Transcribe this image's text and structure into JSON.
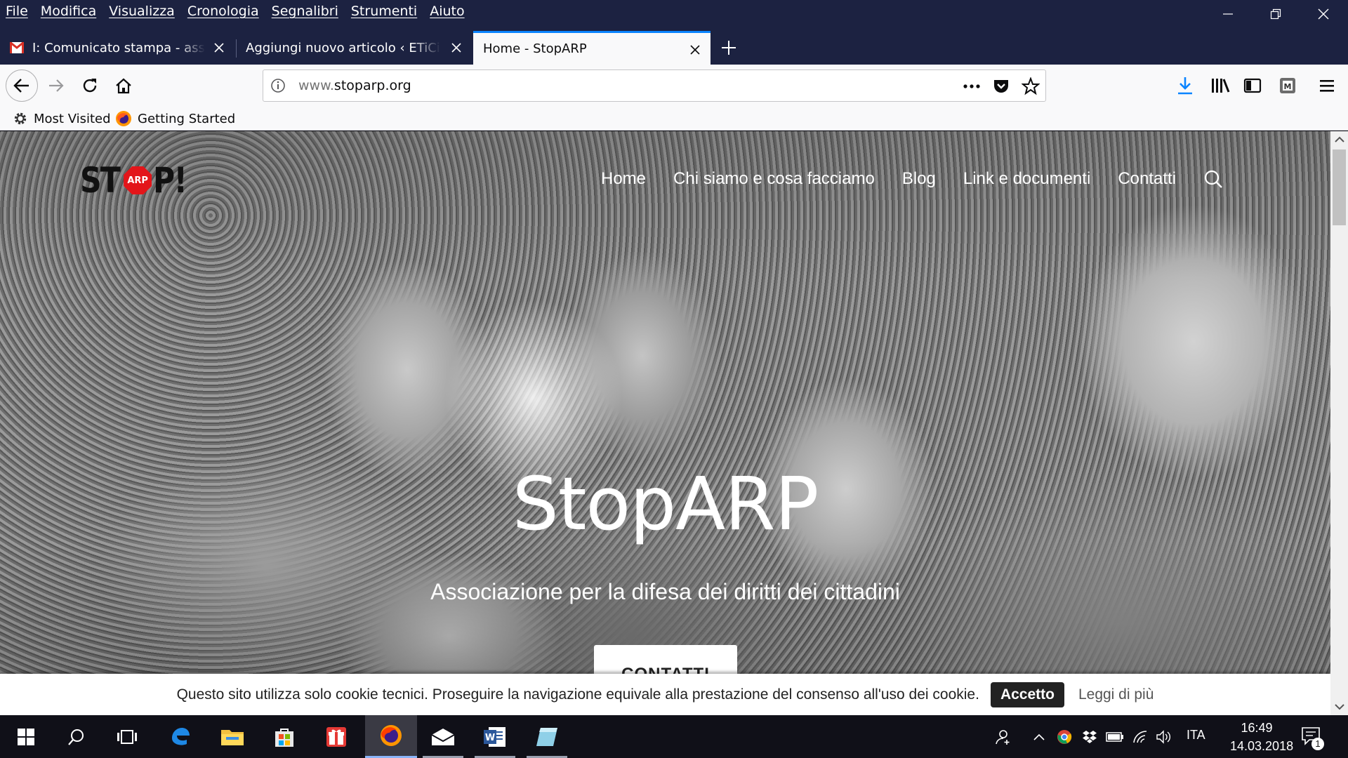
{
  "menu": {
    "items": [
      "File",
      "Modifica",
      "Visualizza",
      "Cronologia",
      "Segnalibri",
      "Strumenti",
      "Aiuto"
    ]
  },
  "tabs": [
    {
      "title": "I: Comunicato stampa - associazione",
      "icon": "gmail-icon",
      "active": false
    },
    {
      "title": "Aggiungi nuovo articolo ‹ ETiCinforma",
      "icon": "",
      "active": false
    },
    {
      "title": "Home - StopARP",
      "icon": "",
      "active": true
    }
  ],
  "urlbar": {
    "url_prefix": "www.",
    "url_domain": "stoparp.org"
  },
  "bookmarks": [
    {
      "label": "Most Visited",
      "icon": "gear-icon"
    },
    {
      "label": "Getting Started",
      "icon": "firefox-icon"
    }
  ],
  "site": {
    "logo": {
      "left": "ST",
      "sign": "ARP",
      "right": "P!"
    },
    "nav": [
      "Home",
      "Chi siamo e cosa facciamo",
      "Blog",
      "Link e documenti",
      "Contatti"
    ],
    "hero_title": "StopARP",
    "hero_subtitle": "Associazione per la difesa dei diritti dei cittadini",
    "hero_button": "CONTATTI"
  },
  "cookie": {
    "text": "Questo sito utilizza solo cookie tecnici. Proseguire la navigazione equivale alla prestazione del consenso all'uso dei cookie.",
    "accept": "Accetto",
    "more": "Leggi di più"
  },
  "taskbar": {
    "language": "ITA",
    "time": "16:49",
    "date": "14.03.2018",
    "notifications": "1"
  },
  "colors": {
    "titlebar": "#1c2241",
    "accent": "#0a84ff",
    "stop_red": "#e3151a"
  }
}
